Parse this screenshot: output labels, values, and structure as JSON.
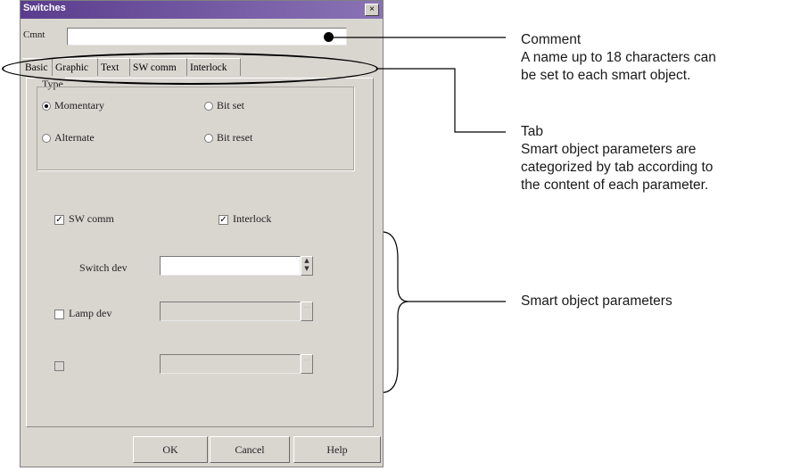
{
  "dialog": {
    "title": "Switches",
    "close_icon_glyph": "×",
    "comment_label": "Cmnt",
    "comment_value": "",
    "tabs": [
      {
        "label": "Basic"
      },
      {
        "label": "Graphic"
      },
      {
        "label": "Text"
      },
      {
        "label": "SW comm"
      },
      {
        "label": "Interlock"
      }
    ],
    "type_group": {
      "legend": "Type",
      "options": [
        {
          "label": "Momentary",
          "selected": true
        },
        {
          "label": "Bit set",
          "selected": false
        },
        {
          "label": "Alternate",
          "selected": false
        },
        {
          "label": "Bit reset",
          "selected": false
        }
      ]
    },
    "checks": {
      "sw_comm": {
        "label": "SW comm",
        "checked": true
      },
      "interlock": {
        "label": "Interlock",
        "checked": true
      }
    },
    "switch_dev": {
      "label": "Switch dev",
      "value": ""
    },
    "lamp_dev": {
      "label": "Lamp dev",
      "checked": false,
      "value": ""
    },
    "third_dev": {
      "label": "",
      "checked": false,
      "value": ""
    },
    "buttons": {
      "ok": "OK",
      "cancel": "Cancel",
      "help": "Help"
    }
  },
  "annotations": {
    "comment": {
      "title": "Comment",
      "line1": "A name up to 18 characters can",
      "line2": "be set to each smart object."
    },
    "tab": {
      "title": "Tab",
      "line1": "Smart object parameters are",
      "line2": "categorized by tab according to",
      "line3": "the content of each parameter."
    },
    "params": {
      "title": "Smart object parameters"
    }
  },
  "colors": {
    "title_bar": "#5a3d8e",
    "dialog_bg": "#d9d6d0",
    "annotation_line": "#000000"
  }
}
